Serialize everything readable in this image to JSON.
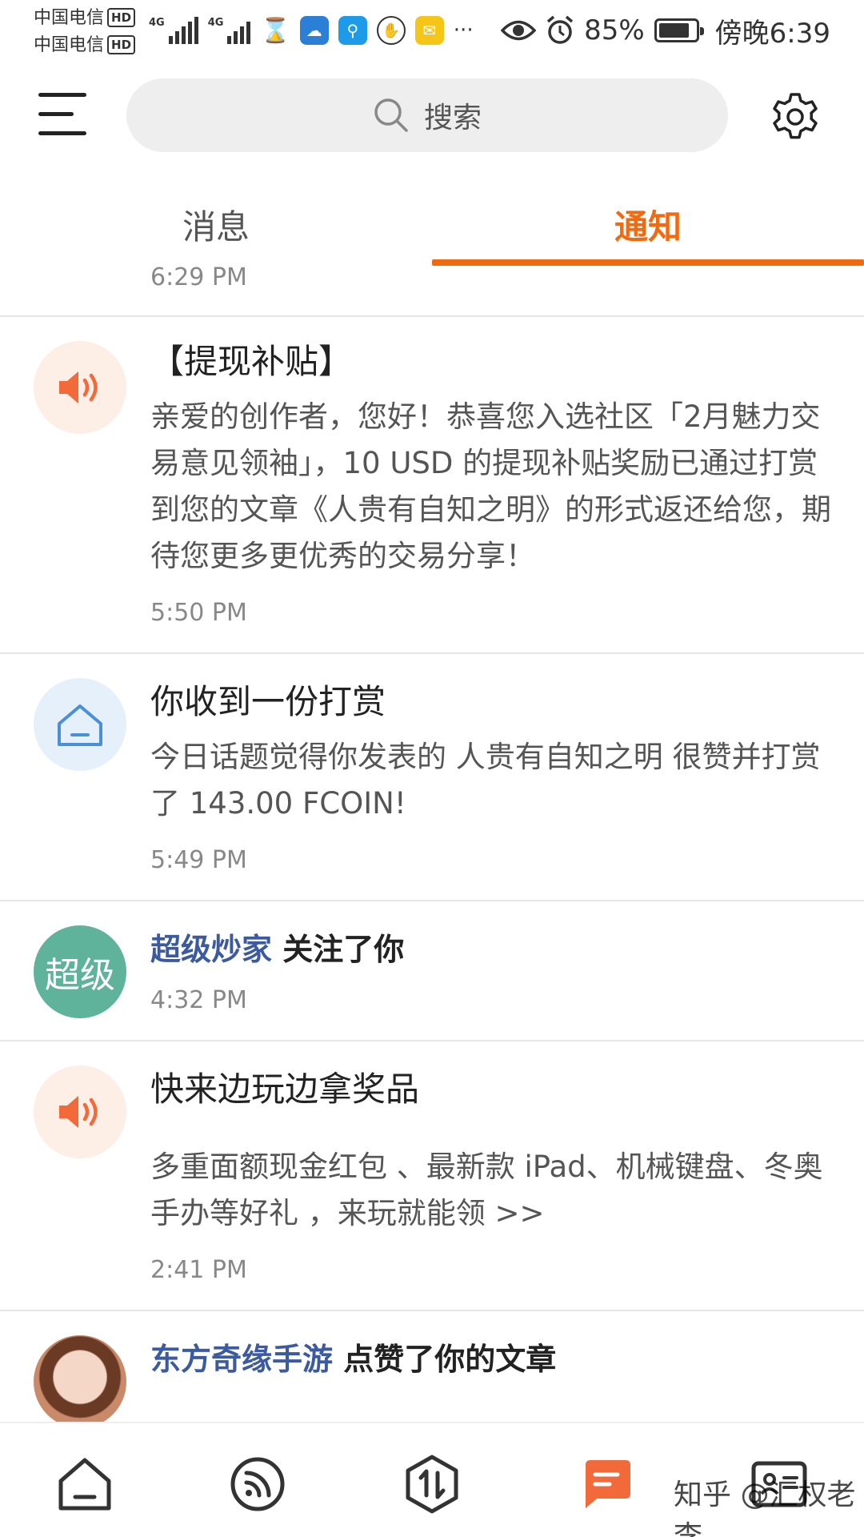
{
  "status_bar": {
    "carrier_1": "中国电信",
    "carrier_2": "中国电信",
    "hd_badge": "HD",
    "network_1": "4G",
    "network_2": "4G",
    "more": "···",
    "battery_percent": "85%",
    "battery_level": 0.85,
    "time": "傍晚6:39"
  },
  "header": {
    "search_placeholder": "搜索"
  },
  "tabs": [
    {
      "label": "消息",
      "active": false
    },
    {
      "label": "通知",
      "active": true
    }
  ],
  "accent_color": "#f26a10",
  "link_color": "#3b5aa0",
  "notifications": {
    "partial_time": "6:29 PM",
    "items": [
      {
        "icon": "speaker-icon",
        "title": "【提现补贴】",
        "body": "亲爱的创作者，您好！恭喜您入选社区「2月魅力交易意见领袖」，10 USD 的提现补贴奖励已通过打赏到您的文章《人贵有自知之明》的形式返还给您，期待您更多更优秀的交易分享！",
        "time": "5:50 PM"
      },
      {
        "icon": "house-icon",
        "title": "你收到一份打赏",
        "body": "今日话题觉得你发表的 人贵有自知之明 很赞并打赏了 143.00 FCOIN!",
        "time": "5:49 PM"
      },
      {
        "avatar_text": "超级",
        "actor": "超级炒家",
        "action": " 关注了你",
        "time": "4:32 PM"
      },
      {
        "icon": "speaker-icon",
        "title": "快来边玩边拿奖品",
        "body": "多重面额现金红包 、最新款 iPad、机械键盘、冬奥手办等好礼 ，来玩就能领 >>",
        "time": "2:41 PM"
      },
      {
        "actor": "东方奇缘手游",
        "action": " 点赞了你的文章"
      }
    ]
  },
  "bottom_nav": [
    {
      "icon": "home-icon",
      "active": false
    },
    {
      "icon": "feed-icon",
      "active": false
    },
    {
      "icon": "trade-icon",
      "active": false
    },
    {
      "icon": "message-icon",
      "active": true
    },
    {
      "icon": "profile-card-icon",
      "active": false
    }
  ],
  "watermark": "知乎 @汇权老李"
}
